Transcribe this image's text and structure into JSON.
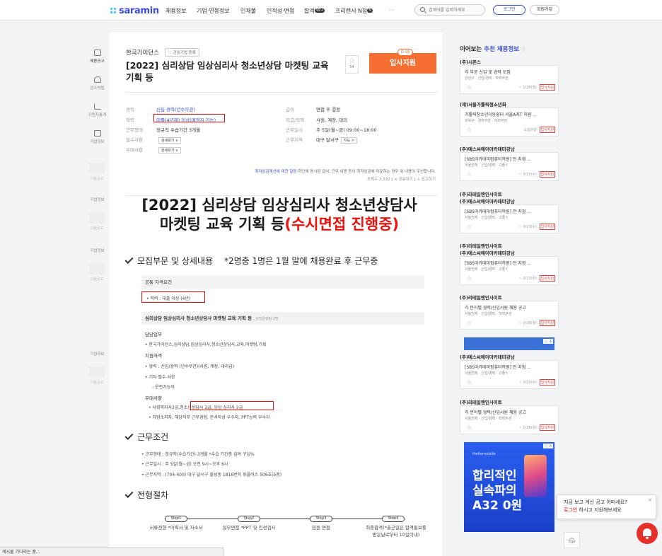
{
  "nav": {
    "logo": "saramin",
    "items": [
      "채용정보",
      "기업·연봉정보",
      "인재풀",
      "인적성·면접",
      "합격",
      "프리랜서·N잡",
      "···"
    ],
    "item_badges": {
      "4": "99+",
      "5": "N"
    },
    "search_placeholder": "검색어를 입력하세요",
    "login": "로그인",
    "signup": "회원가입"
  },
  "left_sidebar": {
    "items": [
      "채용공고",
      "접수방법",
      "지원자통계",
      "기업정보"
    ],
    "ad_labels": [
      "다음공고",
      "다음공고",
      "다음공고",
      "다음공고"
    ],
    "section_labels": [
      "기업정보",
      "기업정보",
      "기업정보"
    ]
  },
  "job": {
    "company": "한국가이던스",
    "interest_btn": "♡ 관심기업 등록",
    "title": "[2022] 심리상담 임상심리사 청소년상담 마켓팅 교육 기획 등",
    "star_count": "54",
    "apply": "입사지원",
    "dday": "D-19",
    "summary_left": [
      {
        "k": "경력",
        "v": "신입·경력(년수무관)"
      },
      {
        "k": "학력",
        "v": "대졸(4년제) 이상(예정자 가능)"
      },
      {
        "k": "근무형태",
        "v": "정규직 수습기간 3개월"
      },
      {
        "k": "필수사항",
        "v": "",
        "btn": "상세보기 ∨"
      },
      {
        "k": "우대사항",
        "v": "",
        "btn": "상세보기 ∨"
      }
    ],
    "summary_right": [
      {
        "k": "급여",
        "v": "면접 후 결정"
      },
      {
        "k": "직급/직책",
        "v": "사원, 계장, 대리"
      },
      {
        "k": "근무일시",
        "v": "주 5일(월~금) 09:00~18:00"
      },
      {
        "k": "근무지역",
        "v": "대구 달서구",
        "btn": "지도 >"
      }
    ],
    "minwage_link": "최저임금계산에 대한 알림",
    "minwage_text": "하단에 명시된 급여, 근무 내용 등이 최저임금에 미달하는 경우 위 내용이 우선합니다.",
    "views": "조회수 2,332",
    "share": "공유하기",
    "report": "신고하기"
  },
  "detail": {
    "big_title_main": "[2022] 심리상담 임상심리사 청소년상담사 마켓팅 교육 기획 등",
    "big_title_red": "(수시면접 진행중)",
    "section1": "모집부문 및 상세내용",
    "section1_note": "*2명중 1명은 1월 말에 채용완료 후 근무중",
    "common_req": "공통 자격요건",
    "edu_req": "• 학력 : 대졸 이상 (4년)",
    "position_bar": "심리상담 임상심리사 청소년상담사 마켓팅 교육 기획 등",
    "position_count": "상담운영팀 2명",
    "duty_head": "담당업무",
    "duty_1": "• 한국가이던스,심리상담,임상심리사,청소년상담사,교육,마켓팅,기획",
    "qual_head": "지원자격",
    "qual_1": "• 경력 : 신입/경력 (년수무관)(사원, 계장, 대리급)",
    "qual_2": "• 기타 필수 사항",
    "qual_3": "- 운전가능자",
    "pref_head": "우대사항",
    "pref_1a": "• 사회복지사2급,",
    "pref_1b": "청소년상담사 2급, 임상 심리사 2급",
    "pref_2": "• 차량소지자, 해당직무 근무경험, 문서작성 우수자, PPT능력 우수자",
    "section2": "근무조건",
    "cond_1": "• 근무형태 : 정규직(수습기간)-3개월    *수습 기간중 급여 구십%",
    "cond_2": "• 근무일시 : 주 5일(월~금) 오전 9시~오후 6시",
    "cond_3": "• 근무지역 : (704-400) 대구 달서구 월성동 1816번지 휴플러스 506호(5층)",
    "section3": "전형절차",
    "steps": [
      {
        "badge": "Step1",
        "text": "서류전형 *이력서 및 자소서"
      },
      {
        "badge": "Step2",
        "text": "실무면접 *PPT 및 인성검사"
      },
      {
        "badge": "Step3",
        "text": "임원 면접"
      },
      {
        "badge": "Step4",
        "text": "최종합격(*출근일은 합격통보를 받은날로부터 10일이내)"
      }
    ]
  },
  "right": {
    "title_pre": "이어보는",
    "title_accent": "추천 채용정보",
    "cards": [
      {
        "co": "(주)시몬스",
        "co2": "",
        "t1": "각 부문 신입 및 경력 모집",
        "t2": "강남구 · 신입/경력 · 학력무관",
        "date": "~ 2/28(월)"
      },
      {
        "co": "(재)서울가톨릭청소년회",
        "co2": "",
        "t1": "가톨릭청소년이동쉼터 서울A지T 직원 ...",
        "t2": "강북구 · 경력무관 · 학력무관",
        "date": "오늘마감"
      },
      {
        "co": "(주)에스씨에이아카데미강남",
        "co2": "",
        "t1": "[SBS아카데미컴퓨터학원] 전 지점 ...",
        "t2": "서울전체 · 신입/경력 · 고졸↑",
        "date": "~ 3/23(수)"
      },
      {
        "co": "(주)리테일앤인사이트",
        "co2": "(주)에스씨에이아카데미강남",
        "t1": "[SBS아카데미컴퓨터학원] 전 지점 ...",
        "t2": "서울전체 · 신입/경력 · 고졸↑",
        "date": "~ 3/23(수)"
      },
      {
        "co": "(주)리테일앤인사이트",
        "co2": "(주)에스씨에이아카데미강남",
        "t1": "[SBS아카데미컴퓨터학원] 전 지점 ...",
        "t2": "서울전체 · 신입/경력 · 고졸↑",
        "date": "~ 3/23(수)"
      },
      {
        "co": "(주)리테일앤인사이트",
        "co2": "",
        "t1": "각 분야별 경력/신입사원 채용 공고",
        "t2": "서울전체 · 신입/경력 · 학력무관",
        "date": "~ 2/28(월)"
      },
      {
        "co": "(주)에스씨에이아카데미강남",
        "co2": "",
        "t1": "[SBS아카데미컴퓨터학원] 전 지점 ...",
        "t2": "서울전체 · 신입/경력 · 고졸↑",
        "date": "~ 3/23(수)"
      },
      {
        "co": "(주)리테일앤인사이트",
        "co2": "",
        "t1": "각 분야별 경력/신입사원 채용 공고",
        "t2": "서울전체 · 신입/경력 · 학력무관",
        "date": "~ 2/28(월)"
      }
    ],
    "apply_label": "입사지원",
    "ad_brand": "Hellomobile",
    "ad_lines": [
      "합리적인",
      "실속파의",
      "A32 0원"
    ],
    "ad_x": "ⓘ X"
  },
  "popup": {
    "line1": "지금 보고 계신 공고 어떠세요?",
    "login": "로그인",
    "line2": " 하시고 지원해보세요",
    "close": "×"
  },
  "top_btn": "TOP",
  "status_text": "게시물 기다리는 중..."
}
